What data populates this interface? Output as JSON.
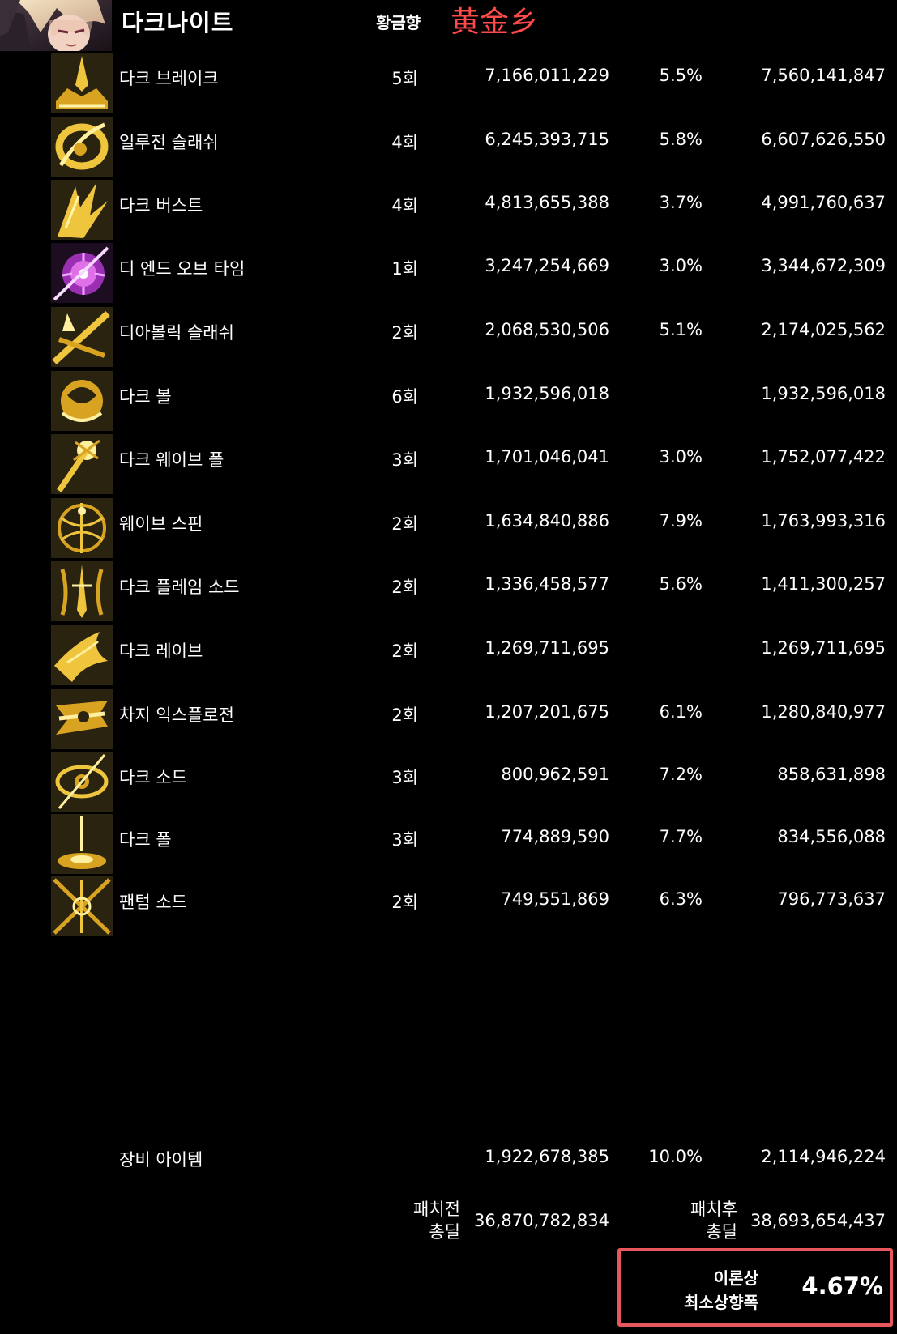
{
  "header": {
    "character_name": "다크나이트",
    "server_label": "황금향",
    "server_name": "黄金乡"
  },
  "skills": [
    {
      "name": "다크 브레이크",
      "hits": "5회",
      "before": "7,166,011,229",
      "pct": "5.5%",
      "after": "7,560,141,847",
      "icon": "dark-break-icon"
    },
    {
      "name": "일루전 슬래쉬",
      "hits": "4회",
      "before": "6,245,393,715",
      "pct": "5.8%",
      "after": "6,607,626,550",
      "icon": "illusion-slash-icon"
    },
    {
      "name": "다크 버스트",
      "hits": "4회",
      "before": "4,813,655,388",
      "pct": "3.7%",
      "after": "4,991,760,637",
      "icon": "dark-burst-icon"
    },
    {
      "name": "디 엔드 오브 타임",
      "hits": "1회",
      "before": "3,247,254,669",
      "pct": "3.0%",
      "after": "3,344,672,309",
      "icon": "end-of-time-icon"
    },
    {
      "name": "디아볼릭 슬래쉬",
      "hits": "2회",
      "before": "2,068,530,506",
      "pct": "5.1%",
      "after": "2,174,025,562",
      "icon": "diabolic-slash-icon"
    },
    {
      "name": "다크 볼",
      "hits": "6회",
      "before": "1,932,596,018",
      "pct": "",
      "after": "1,932,596,018",
      "icon": "dark-ball-icon"
    },
    {
      "name": "다크 웨이브 폴",
      "hits": "3회",
      "before": "1,701,046,041",
      "pct": "3.0%",
      "after": "1,752,077,422",
      "icon": "dark-wave-fall-icon"
    },
    {
      "name": "웨이브 스핀",
      "hits": "2회",
      "before": "1,634,840,886",
      "pct": "7.9%",
      "after": "1,763,993,316",
      "icon": "wave-spin-icon"
    },
    {
      "name": "다크 플레임 소드",
      "hits": "2회",
      "before": "1,336,458,577",
      "pct": "5.6%",
      "after": "1,411,300,257",
      "icon": "dark-flame-sword-icon"
    },
    {
      "name": "다크 레이브",
      "hits": "2회",
      "before": "1,269,711,695",
      "pct": "",
      "after": "1,269,711,695",
      "icon": "dark-rave-icon"
    },
    {
      "name": "차지 익스플로전",
      "hits": "2회",
      "before": "1,207,201,675",
      "pct": "6.1%",
      "after": "1,280,840,977",
      "icon": "charge-explosion-icon"
    },
    {
      "name": "다크 소드",
      "hits": "3회",
      "before": "800,962,591",
      "pct": "7.2%",
      "after": "858,631,898",
      "icon": "dark-sword-icon"
    },
    {
      "name": "다크 폴",
      "hits": "3회",
      "before": "774,889,590",
      "pct": "7.7%",
      "after": "834,556,088",
      "icon": "dark-fall-icon"
    },
    {
      "name": "팬텀 소드",
      "hits": "2회",
      "before": "749,551,869",
      "pct": "6.3%",
      "after": "796,773,637",
      "icon": "phantom-sword-icon"
    }
  ],
  "equipment": {
    "name": "장비 아이템",
    "before": "1,922,678,385",
    "pct": "10.0%",
    "after": "2,114,946,224"
  },
  "totals": {
    "before_label_line1": "패치전",
    "before_label_line2": "총딜",
    "before_value": "36,870,782,834",
    "after_label_line1": "패치후",
    "after_label_line2": "총딜",
    "after_value": "38,693,654,437"
  },
  "result": {
    "label_line1": "이론상",
    "label_line2": "최소상향폭",
    "value": "4.67%"
  },
  "colors": {
    "background": "#000000",
    "text": "#ffffff",
    "server_name": "#ff4a4a",
    "highlight_border": "#e8575b",
    "icon_gold": "#e0b437",
    "icon_purple": "#b03cc8"
  }
}
